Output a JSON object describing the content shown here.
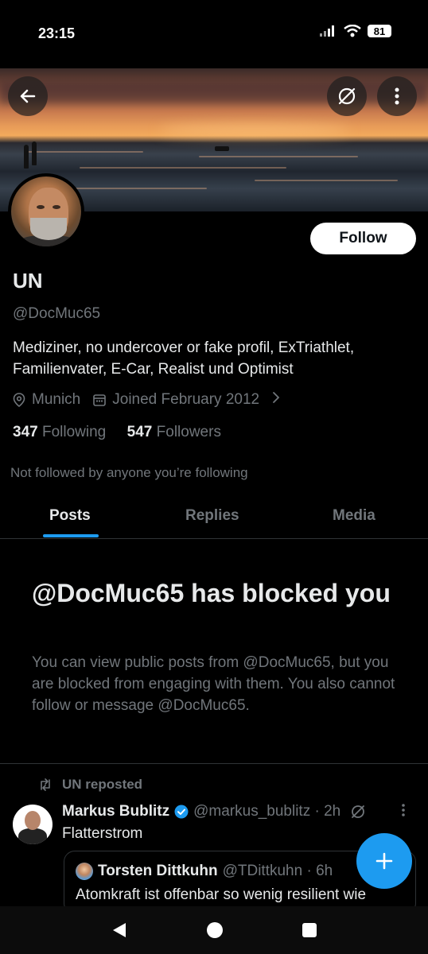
{
  "status_bar": {
    "time": "23:15",
    "battery": "81"
  },
  "profile": {
    "follow_label": "Follow",
    "name": "UN",
    "handle": "@DocMuc65",
    "bio": "Mediziner, no undercover or fake profil, ExTriathlet, Familienvater, E-Car, Realist und Optimist",
    "location": "Munich",
    "joined": "Joined February 2012",
    "following_count": "347",
    "following_label": "Following",
    "followers_count": "547",
    "followers_label": "Followers",
    "not_followed_note": "Not followed by anyone you’re following"
  },
  "tabs": [
    {
      "label": "Posts",
      "active": true
    },
    {
      "label": "Replies",
      "active": false
    },
    {
      "label": "Media",
      "active": false
    }
  ],
  "blocked": {
    "title": "@DocMuc65 has blocked you",
    "description": "You can view public posts from @DocMuc65, but you are blocked from engaging with them. You also cannot follow or message @DocMuc65."
  },
  "post": {
    "repost_label": "UN reposted",
    "author_name": "Markus Bublitz",
    "author_meta": "@markus_bublitz · 2h",
    "text": "Flatterstrom",
    "quote": {
      "author_name": "Torsten Dittkuhn",
      "author_meta": "@TDittkuhn · 6h",
      "text": "Atomkraft ist offenbar so wenig resilient wie"
    }
  },
  "colors": {
    "accent": "#1d9bf0",
    "muted": "#71767b",
    "text": "#e7e9ea",
    "background": "#000000"
  },
  "icons": [
    "back-arrow-icon",
    "grok-icon",
    "more-vertical-icon",
    "location-pin-icon",
    "calendar-icon",
    "chevron-right-icon",
    "repost-icon",
    "verified-badge-icon",
    "plus-icon",
    "nav-back-icon",
    "nav-home-icon",
    "nav-recents-icon"
  ]
}
